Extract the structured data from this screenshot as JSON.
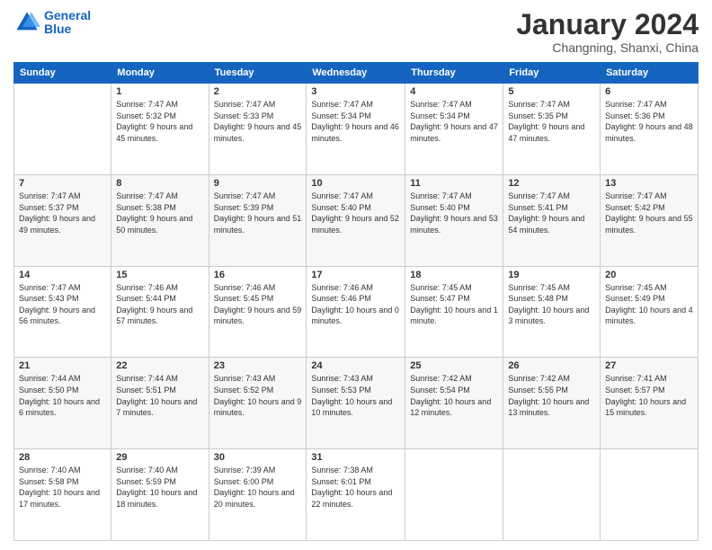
{
  "header": {
    "logo_line1": "General",
    "logo_line2": "Blue",
    "main_title": "January 2024",
    "subtitle": "Changning, Shanxi, China"
  },
  "calendar": {
    "columns": [
      "Sunday",
      "Monday",
      "Tuesday",
      "Wednesday",
      "Thursday",
      "Friday",
      "Saturday"
    ],
    "weeks": [
      [
        {
          "day": "",
          "sunrise": "",
          "sunset": "",
          "daylight": ""
        },
        {
          "day": "1",
          "sunrise": "Sunrise: 7:47 AM",
          "sunset": "Sunset: 5:32 PM",
          "daylight": "Daylight: 9 hours and 45 minutes."
        },
        {
          "day": "2",
          "sunrise": "Sunrise: 7:47 AM",
          "sunset": "Sunset: 5:33 PM",
          "daylight": "Daylight: 9 hours and 45 minutes."
        },
        {
          "day": "3",
          "sunrise": "Sunrise: 7:47 AM",
          "sunset": "Sunset: 5:34 PM",
          "daylight": "Daylight: 9 hours and 46 minutes."
        },
        {
          "day": "4",
          "sunrise": "Sunrise: 7:47 AM",
          "sunset": "Sunset: 5:34 PM",
          "daylight": "Daylight: 9 hours and 47 minutes."
        },
        {
          "day": "5",
          "sunrise": "Sunrise: 7:47 AM",
          "sunset": "Sunset: 5:35 PM",
          "daylight": "Daylight: 9 hours and 47 minutes."
        },
        {
          "day": "6",
          "sunrise": "Sunrise: 7:47 AM",
          "sunset": "Sunset: 5:36 PM",
          "daylight": "Daylight: 9 hours and 48 minutes."
        }
      ],
      [
        {
          "day": "7",
          "sunrise": "Sunrise: 7:47 AM",
          "sunset": "Sunset: 5:37 PM",
          "daylight": "Daylight: 9 hours and 49 minutes."
        },
        {
          "day": "8",
          "sunrise": "Sunrise: 7:47 AM",
          "sunset": "Sunset: 5:38 PM",
          "daylight": "Daylight: 9 hours and 50 minutes."
        },
        {
          "day": "9",
          "sunrise": "Sunrise: 7:47 AM",
          "sunset": "Sunset: 5:39 PM",
          "daylight": "Daylight: 9 hours and 51 minutes."
        },
        {
          "day": "10",
          "sunrise": "Sunrise: 7:47 AM",
          "sunset": "Sunset: 5:40 PM",
          "daylight": "Daylight: 9 hours and 52 minutes."
        },
        {
          "day": "11",
          "sunrise": "Sunrise: 7:47 AM",
          "sunset": "Sunset: 5:40 PM",
          "daylight": "Daylight: 9 hours and 53 minutes."
        },
        {
          "day": "12",
          "sunrise": "Sunrise: 7:47 AM",
          "sunset": "Sunset: 5:41 PM",
          "daylight": "Daylight: 9 hours and 54 minutes."
        },
        {
          "day": "13",
          "sunrise": "Sunrise: 7:47 AM",
          "sunset": "Sunset: 5:42 PM",
          "daylight": "Daylight: 9 hours and 55 minutes."
        }
      ],
      [
        {
          "day": "14",
          "sunrise": "Sunrise: 7:47 AM",
          "sunset": "Sunset: 5:43 PM",
          "daylight": "Daylight: 9 hours and 56 minutes."
        },
        {
          "day": "15",
          "sunrise": "Sunrise: 7:46 AM",
          "sunset": "Sunset: 5:44 PM",
          "daylight": "Daylight: 9 hours and 57 minutes."
        },
        {
          "day": "16",
          "sunrise": "Sunrise: 7:46 AM",
          "sunset": "Sunset: 5:45 PM",
          "daylight": "Daylight: 9 hours and 59 minutes."
        },
        {
          "day": "17",
          "sunrise": "Sunrise: 7:46 AM",
          "sunset": "Sunset: 5:46 PM",
          "daylight": "Daylight: 10 hours and 0 minutes."
        },
        {
          "day": "18",
          "sunrise": "Sunrise: 7:45 AM",
          "sunset": "Sunset: 5:47 PM",
          "daylight": "Daylight: 10 hours and 1 minute."
        },
        {
          "day": "19",
          "sunrise": "Sunrise: 7:45 AM",
          "sunset": "Sunset: 5:48 PM",
          "daylight": "Daylight: 10 hours and 3 minutes."
        },
        {
          "day": "20",
          "sunrise": "Sunrise: 7:45 AM",
          "sunset": "Sunset: 5:49 PM",
          "daylight": "Daylight: 10 hours and 4 minutes."
        }
      ],
      [
        {
          "day": "21",
          "sunrise": "Sunrise: 7:44 AM",
          "sunset": "Sunset: 5:50 PM",
          "daylight": "Daylight: 10 hours and 6 minutes."
        },
        {
          "day": "22",
          "sunrise": "Sunrise: 7:44 AM",
          "sunset": "Sunset: 5:51 PM",
          "daylight": "Daylight: 10 hours and 7 minutes."
        },
        {
          "day": "23",
          "sunrise": "Sunrise: 7:43 AM",
          "sunset": "Sunset: 5:52 PM",
          "daylight": "Daylight: 10 hours and 9 minutes."
        },
        {
          "day": "24",
          "sunrise": "Sunrise: 7:43 AM",
          "sunset": "Sunset: 5:53 PM",
          "daylight": "Daylight: 10 hours and 10 minutes."
        },
        {
          "day": "25",
          "sunrise": "Sunrise: 7:42 AM",
          "sunset": "Sunset: 5:54 PM",
          "daylight": "Daylight: 10 hours and 12 minutes."
        },
        {
          "day": "26",
          "sunrise": "Sunrise: 7:42 AM",
          "sunset": "Sunset: 5:55 PM",
          "daylight": "Daylight: 10 hours and 13 minutes."
        },
        {
          "day": "27",
          "sunrise": "Sunrise: 7:41 AM",
          "sunset": "Sunset: 5:57 PM",
          "daylight": "Daylight: 10 hours and 15 minutes."
        }
      ],
      [
        {
          "day": "28",
          "sunrise": "Sunrise: 7:40 AM",
          "sunset": "Sunset: 5:58 PM",
          "daylight": "Daylight: 10 hours and 17 minutes."
        },
        {
          "day": "29",
          "sunrise": "Sunrise: 7:40 AM",
          "sunset": "Sunset: 5:59 PM",
          "daylight": "Daylight: 10 hours and 18 minutes."
        },
        {
          "day": "30",
          "sunrise": "Sunrise: 7:39 AM",
          "sunset": "Sunset: 6:00 PM",
          "daylight": "Daylight: 10 hours and 20 minutes."
        },
        {
          "day": "31",
          "sunrise": "Sunrise: 7:38 AM",
          "sunset": "Sunset: 6:01 PM",
          "daylight": "Daylight: 10 hours and 22 minutes."
        },
        {
          "day": "",
          "sunrise": "",
          "sunset": "",
          "daylight": ""
        },
        {
          "day": "",
          "sunrise": "",
          "sunset": "",
          "daylight": ""
        },
        {
          "day": "",
          "sunrise": "",
          "sunset": "",
          "daylight": ""
        }
      ]
    ]
  }
}
